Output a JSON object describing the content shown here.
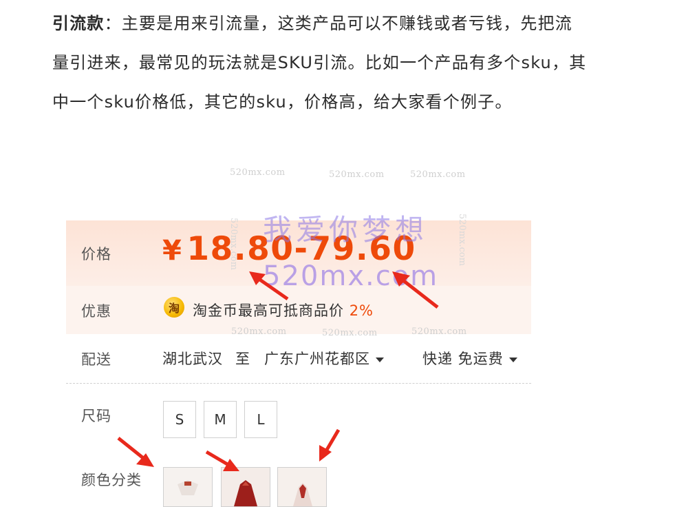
{
  "article": {
    "bold_term": "引流款",
    "line1_rest": "：主要是用来引流量，这类产品可以不赚钱或者亏钱，先把流",
    "line2": "量引进来，最常见的玩法就是SKU引流。比如一个产品有多个sku，其",
    "line3": "中一个sku价格低，其它的sku，价格高，给大家看个例子。"
  },
  "product": {
    "price_label": "价格",
    "currency": "¥",
    "price_range": "18.80-79.60",
    "promo_label": "优惠",
    "promo_icon_char": "淘",
    "promo_text": "淘金币最高可抵商品价",
    "promo_percent": "2%",
    "shipping_label": "配送",
    "ship_from": "湖北武汉",
    "ship_to_word": "至",
    "ship_to": "广东广州花都区",
    "ship_method": "快递 免运费",
    "size_label": "尺码",
    "sizes": [
      "S",
      "M",
      "L"
    ],
    "color_label": "颜色分类"
  },
  "watermark": {
    "small": "520mx.com",
    "cn": "我爱你梦想",
    "en": "520mx.com"
  },
  "colors": {
    "price": "#ee4a0a",
    "arrow": "#e8291c",
    "price_bg": "#fde3d6"
  }
}
